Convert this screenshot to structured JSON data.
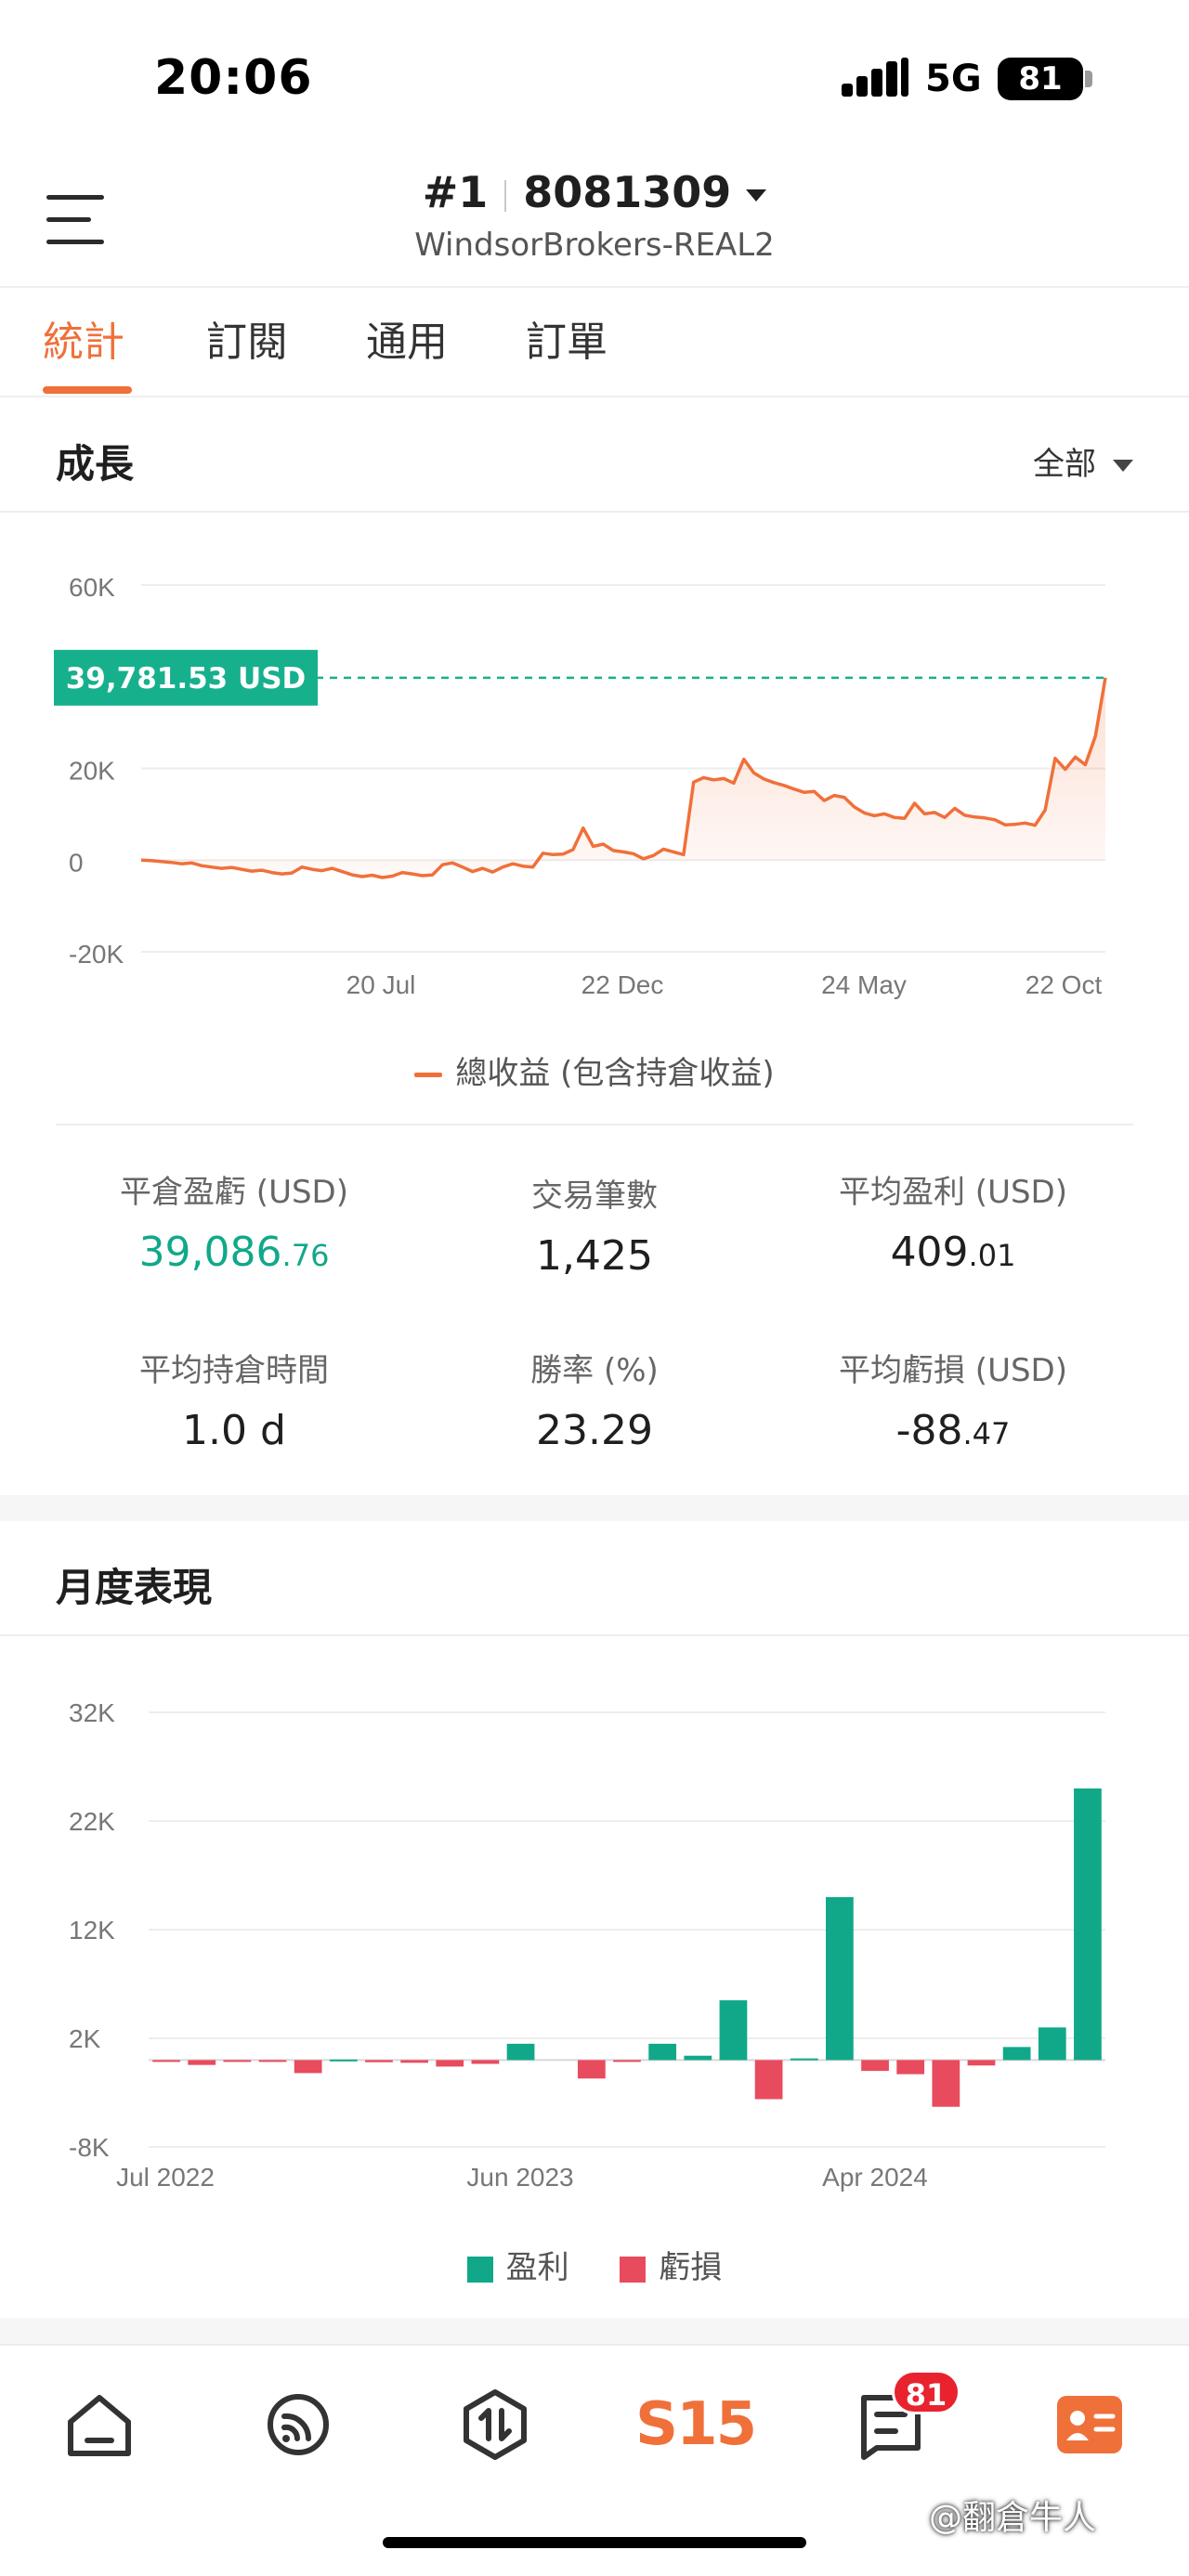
{
  "status_bar": {
    "time": "20:06",
    "network": "5G",
    "battery": "81"
  },
  "header": {
    "account_number": "#1",
    "account_id": "8081309",
    "broker": "WindsorBrokers-REAL2"
  },
  "tabs": [
    {
      "label": "統計",
      "active": true
    },
    {
      "label": "訂閱",
      "active": false
    },
    {
      "label": "通用",
      "active": false
    },
    {
      "label": "訂單",
      "active": false
    }
  ],
  "growth": {
    "title": "成長",
    "filter_label": "全部",
    "badge_value": "39,781.53 USD",
    "legend": "總收益 (包含持倉收益)"
  },
  "stats": [
    {
      "label": "平倉盈虧 (USD)",
      "value_main": "39,086",
      "value_small": ".76",
      "color": "#11a88a"
    },
    {
      "label": "交易筆數",
      "value_main": "1,425",
      "value_small": ""
    },
    {
      "label": "平均盈利 (USD)",
      "value_main": "409",
      "value_small": ".01"
    },
    {
      "label": "平均持倉時間",
      "value_main": "1.0 d",
      "value_small": ""
    },
    {
      "label": "勝率 (%)",
      "value_main": "23.29",
      "value_small": ""
    },
    {
      "label": "平均虧損 (USD)",
      "value_main": "-88",
      "value_small": ".47"
    }
  ],
  "monthly": {
    "title": "月度表現",
    "legend_profit": "盈利",
    "legend_loss": "虧損"
  },
  "colors": {
    "accent": "#f0703a",
    "profit": "#11a88a",
    "loss": "#e84b5e",
    "badge": "#17b08d"
  },
  "nav": {
    "items": [
      "home-icon",
      "feed-icon",
      "trade-icon",
      "s15-logo",
      "messages-icon",
      "profile-icon"
    ],
    "logo_text": "S15",
    "messages_badge": "81"
  },
  "watermark": "@翻倉牛人",
  "chart_data": [
    {
      "type": "area",
      "x_ticks": [
        "20 Jul",
        "22 Dec",
        "24 May",
        "22 Oct"
      ],
      "y_ticks": [
        "60K",
        "20K",
        "0",
        "-20K"
      ],
      "ylim": [
        -20000,
        60000
      ],
      "reference_value": 39781.53,
      "series": [
        {
          "name": "總收益 (包含持倉收益)",
          "values": [
            0,
            -100,
            -300,
            -500,
            -800,
            -600,
            -1200,
            -1500,
            -1800,
            -1600,
            -2000,
            -2400,
            -2200,
            -2700,
            -3000,
            -2800,
            -1500,
            -2000,
            -2300,
            -1800,
            -2500,
            -3200,
            -3600,
            -3300,
            -3800,
            -3500,
            -2700,
            -3000,
            -3400,
            -3200,
            -1000,
            -600,
            -1500,
            -2500,
            -1800,
            -2600,
            -1500,
            -800,
            -1300,
            -1500,
            1500,
            1200,
            1300,
            2300,
            7000,
            3000,
            3500,
            2100,
            1800,
            1400,
            300,
            1000,
            2400,
            1800,
            1200,
            17000,
            18000,
            17500,
            17800,
            16800,
            22000,
            19000,
            17700,
            16900,
            16300,
            15500,
            14800,
            15000,
            13000,
            14100,
            13700,
            11600,
            10300,
            9700,
            10100,
            9300,
            9100,
            12400,
            10100,
            10400,
            9300,
            11300,
            9800,
            9400,
            9200,
            8800,
            7700,
            7800,
            8100,
            7600,
            10900,
            22200,
            19800,
            22500,
            20800,
            27000,
            39781.53
          ]
        }
      ]
    },
    {
      "type": "bar",
      "x_ticks": [
        "Jul 2022",
        "Jun 2023",
        "Apr 2024"
      ],
      "y_ticks": [
        "32K",
        "22K",
        "12K",
        "2K",
        "-8K"
      ],
      "ylim": [
        -8000,
        32000
      ],
      "series": [
        {
          "name": "盈利",
          "values": [
            0,
            0,
            0,
            0,
            0,
            50,
            0,
            0,
            0,
            0,
            1500,
            0,
            0,
            0,
            1500,
            400,
            5500,
            0,
            150,
            15000,
            0,
            0,
            0,
            0,
            1200,
            3000,
            25000
          ]
        },
        {
          "name": "虧損",
          "values": [
            -150,
            -450,
            -150,
            -150,
            -1200,
            0,
            -200,
            -250,
            -600,
            -350,
            0,
            0,
            -1700,
            -150,
            0,
            0,
            0,
            -3600,
            0,
            0,
            -1000,
            -1300,
            -4300,
            -500,
            0,
            0,
            0
          ]
        }
      ]
    }
  ]
}
